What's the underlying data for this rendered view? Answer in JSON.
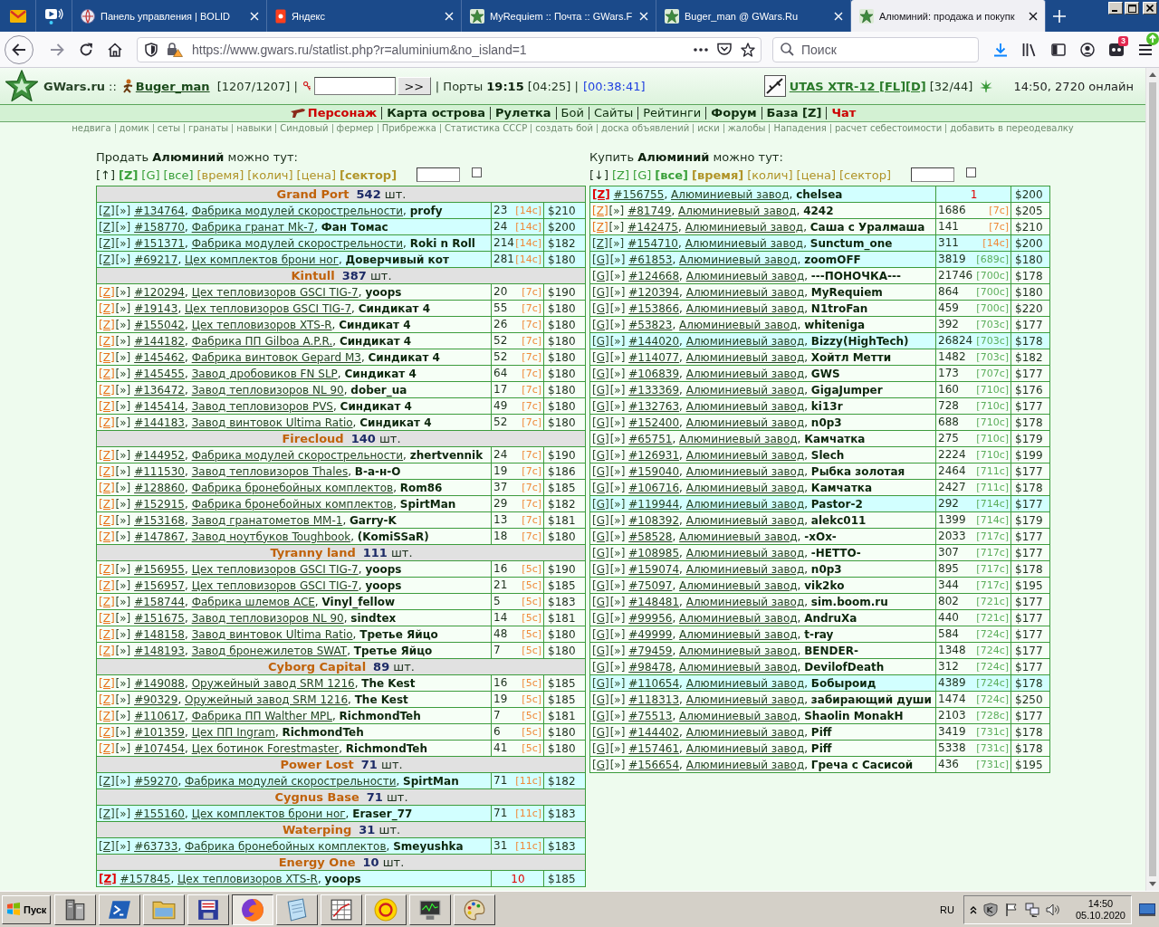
{
  "browser": {
    "tabs": [
      {
        "kind": "pinned",
        "selected": false
      },
      {
        "kind": "pinned",
        "selected": false
      },
      {
        "kind": "page",
        "label": "Панель управления | BOLID",
        "selected": false
      },
      {
        "kind": "page",
        "label": "Яндекс",
        "selected": false
      },
      {
        "kind": "page",
        "label": "MyRequiem :: Почта :: GWars.F",
        "selected": false
      },
      {
        "kind": "page",
        "label": "Buger_man @ GWars.Ru",
        "selected": false
      },
      {
        "kind": "page",
        "label": "Алюминий: продажа и покупк",
        "selected": true
      }
    ]
  },
  "toolbar": {
    "url": "https://www.gwars.ru/statlist.php?r=aluminium&no_island=1",
    "search_placeholder": "Поиск",
    "badge": "3"
  },
  "header": {
    "logo": "GWars.ru",
    "logo_sep": "::",
    "user": "Buger_man",
    "health": "[1207/1207] |",
    "go_button": ">>",
    "ports": "| Порты **19:15** [04:25] |",
    "timer": "[00:38:41]",
    "weapon": "UTAS XTR-12 [FL][D]",
    "ammo": "[32/44]",
    "online": "14:50, 2720 онлайн"
  },
  "nav": {
    "items": [
      {
        "label": "Персонаж",
        "bold": true,
        "color": "#cc0000"
      },
      {
        "label": "Карта острова",
        "bold": true,
        "color": "#0f2f0f"
      },
      {
        "label": "Рулетка",
        "bold": true,
        "color": "#0f2f0f"
      },
      {
        "label": "Бой",
        "bold": false,
        "color": "#0f2f0f"
      },
      {
        "label": "Сайты",
        "bold": false,
        "color": "#0f2f0f"
      },
      {
        "label": "Рейтинги",
        "bold": false,
        "color": "#0f2f0f"
      },
      {
        "label": "Форум",
        "bold": true,
        "color": "#0f2f0f"
      },
      {
        "label": "База [Z]",
        "bold": true,
        "color": "#0f2f0f"
      },
      {
        "label": "Чат",
        "bold": true,
        "color": "#cc0000"
      }
    ],
    "links": [
      "недвига",
      "домик",
      "сеты",
      "гранаты",
      "навыки",
      "Синдовый",
      "фермер",
      "Прибрежка",
      "Статистика СССР",
      "создать бой",
      "доска объявлений",
      "иски",
      "жалобы",
      "Нападения",
      "расчет себестоимости",
      "добавить в переодевалку"
    ]
  },
  "sell": {
    "title": "Продать **Алюминий** можно тут:",
    "filters": [
      {
        "label": "[↑]",
        "kind": "direction",
        "selected": false
      },
      {
        "label": "[Z]",
        "kind": "filter",
        "selected": true
      },
      {
        "label": "[G]",
        "kind": "filter",
        "selected": false
      },
      {
        "label": "[все]",
        "kind": "filter",
        "selected": false
      },
      {
        "label": "[время]",
        "kind": "sort",
        "selected": false
      },
      {
        "label": "[колич]",
        "kind": "sort",
        "selected": false
      },
      {
        "label": "[цена]",
        "kind": "sort",
        "selected": false
      },
      {
        "label": "[сектор]",
        "kind": "sort",
        "selected": true
      }
    ],
    "checkbox": {
      "checked": false
    },
    "separator": ",",
    "groups": [
      {
        "island": "Grand Port",
        "count": "542",
        "unit": "шт.",
        "rows": [
          {
            "kind": "offer",
            "highlighted": true,
            "tag": "[Z]",
            "tag_accent": false,
            "go": "[»]",
            "id": "#134764",
            "factory": "Фабрика модулей скорострельности",
            "owner": "profy",
            "qty": "23",
            "time": "[14c]",
            "time_accent": true,
            "price": "$210"
          },
          {
            "kind": "offer",
            "highlighted": true,
            "tag": "[Z]",
            "tag_accent": false,
            "go": "[»]",
            "id": "#158770",
            "factory": "Фабрика гранат Mk-7",
            "owner": "Фан Томас",
            "qty": "24",
            "time": "[14c]",
            "time_accent": true,
            "price": "$200"
          },
          {
            "kind": "offer",
            "highlighted": true,
            "tag": "[Z]",
            "tag_accent": false,
            "go": "[»]",
            "id": "#151371",
            "factory": "Фабрика модулей скорострельности",
            "owner": "Roki n Roll",
            "qty": "214",
            "time": "[14c]",
            "time_accent": true,
            "price": "$182"
          },
          {
            "kind": "offer",
            "highlighted": true,
            "tag": "[Z]",
            "tag_accent": false,
            "go": "[»]",
            "id": "#69217",
            "factory": "Цех комплектов брони ног",
            "owner": "Доверчивый кот",
            "qty": "281",
            "time": "[14c]",
            "time_accent": true,
            "price": "$180"
          }
        ]
      },
      {
        "island": "Kintull",
        "count": "387",
        "unit": "шт.",
        "rows": [
          {
            "kind": "offer",
            "highlighted": false,
            "tag": "[Z]",
            "tag_accent": true,
            "go": "[»]",
            "id": "#120294",
            "factory": "Цех тепловизоров GSCI TIG-7",
            "owner": "yoops",
            "qty": "20",
            "time": "[7c]",
            "time_accent": true,
            "price": "$190"
          },
          {
            "kind": "offer",
            "highlighted": false,
            "tag": "[Z]",
            "tag_accent": true,
            "go": "[»]",
            "id": "#19143",
            "factory": "Цех тепловизоров GSCI TIG-7",
            "owner": "Синдикат 4",
            "qty": "55",
            "time": "[7c]",
            "time_accent": true,
            "price": "$180"
          },
          {
            "kind": "offer",
            "highlighted": false,
            "tag": "[Z]",
            "tag_accent": true,
            "go": "[»]",
            "id": "#155042",
            "factory": "Цех тепловизоров XTS-R",
            "owner": "Синдикат 4",
            "qty": "26",
            "time": "[7c]",
            "time_accent": true,
            "price": "$180"
          },
          {
            "kind": "offer",
            "highlighted": false,
            "tag": "[Z]",
            "tag_accent": true,
            "go": "[»]",
            "id": "#144182",
            "factory": "Фабрика ПП Gilboa A.P.R.",
            "owner": "Синдикат 4",
            "qty": "52",
            "time": "[7c]",
            "time_accent": true,
            "price": "$180"
          },
          {
            "kind": "offer",
            "highlighted": false,
            "tag": "[Z]",
            "tag_accent": true,
            "go": "[»]",
            "id": "#145462",
            "factory": "Фабрика винтовок Gepard M3",
            "owner": "Синдикат 4",
            "qty": "52",
            "time": "[7c]",
            "time_accent": true,
            "price": "$180"
          },
          {
            "kind": "offer",
            "highlighted": false,
            "tag": "[Z]",
            "tag_accent": true,
            "go": "[»]",
            "id": "#145455",
            "factory": "Завод дробовиков FN SLP",
            "owner": "Синдикат 4",
            "qty": "64",
            "time": "[7c]",
            "time_accent": true,
            "price": "$180"
          },
          {
            "kind": "offer",
            "highlighted": false,
            "tag": "[Z]",
            "tag_accent": true,
            "go": "[»]",
            "id": "#136472",
            "factory": "Завод тепловизоров NL 90",
            "owner": "dober_ua",
            "qty": "17",
            "time": "[7c]",
            "time_accent": true,
            "price": "$180"
          },
          {
            "kind": "offer",
            "highlighted": false,
            "tag": "[Z]",
            "tag_accent": true,
            "go": "[»]",
            "id": "#145414",
            "factory": "Завод тепловизоров PVS",
            "owner": "Синдикат 4",
            "qty": "49",
            "time": "[7c]",
            "time_accent": true,
            "price": "$180"
          },
          {
            "kind": "offer",
            "highlighted": false,
            "tag": "[Z]",
            "tag_accent": true,
            "go": "[»]",
            "id": "#144183",
            "factory": "Завод винтовок Ultima Ratio",
            "owner": "Синдикат 4",
            "qty": "52",
            "time": "[7c]",
            "time_accent": true,
            "price": "$180"
          }
        ]
      },
      {
        "island": "Firecloud",
        "count": "140",
        "unit": "шт.",
        "rows": [
          {
            "kind": "offer",
            "highlighted": false,
            "tag": "[Z]",
            "tag_accent": true,
            "go": "[»]",
            "id": "#144952",
            "factory": "Фабрика модулей скорострельности",
            "owner": "zhertvennik",
            "qty": "24",
            "time": "[7c]",
            "time_accent": true,
            "price": "$190"
          },
          {
            "kind": "offer",
            "highlighted": false,
            "tag": "[Z]",
            "tag_accent": true,
            "go": "[»]",
            "id": "#111530",
            "factory": "Завод тепловизоров Thales",
            "owner": "В-а-н-О",
            "qty": "19",
            "time": "[7c]",
            "time_accent": true,
            "price": "$186"
          },
          {
            "kind": "offer",
            "highlighted": false,
            "tag": "[Z]",
            "tag_accent": true,
            "go": "[»]",
            "id": "#128860",
            "factory": "Фабрика бронебойных комплектов",
            "owner": "Rom86",
            "qty": "37",
            "time": "[7c]",
            "time_accent": true,
            "price": "$185"
          },
          {
            "kind": "offer",
            "highlighted": false,
            "tag": "[Z]",
            "tag_accent": true,
            "go": "[»]",
            "id": "#152915",
            "factory": "Фабрика бронебойных комплектов",
            "owner": "SpirtMan",
            "qty": "29",
            "time": "[7c]",
            "time_accent": true,
            "price": "$182"
          },
          {
            "kind": "offer",
            "highlighted": false,
            "tag": "[Z]",
            "tag_accent": true,
            "go": "[»]",
            "id": "#153168",
            "factory": "Завод гранатометов MM-1",
            "owner": "Garry-K",
            "qty": "13",
            "time": "[7c]",
            "time_accent": true,
            "price": "$181"
          },
          {
            "kind": "offer",
            "highlighted": false,
            "tag": "[Z]",
            "tag_accent": true,
            "go": "[»]",
            "id": "#147867",
            "factory": "Завод ноутбуков Toughbook",
            "owner": "(KomiSSaR)",
            "qty": "18",
            "time": "[7c]",
            "time_accent": true,
            "price": "$180"
          }
        ]
      },
      {
        "island": "Tyranny land",
        "count": "111",
        "unit": "шт.",
        "rows": [
          {
            "kind": "offer",
            "highlighted": false,
            "tag": "[Z]",
            "tag_accent": true,
            "go": "[»]",
            "id": "#156955",
            "factory": "Цех тепловизоров GSCI TIG-7",
            "owner": "yoops",
            "qty": "16",
            "time": "[5c]",
            "time_accent": true,
            "price": "$190"
          },
          {
            "kind": "offer",
            "highlighted": false,
            "tag": "[Z]",
            "tag_accent": true,
            "go": "[»]",
            "id": "#156957",
            "factory": "Цех тепловизоров GSCI TIG-7",
            "owner": "yoops",
            "qty": "21",
            "time": "[5c]",
            "time_accent": true,
            "price": "$185"
          },
          {
            "kind": "offer",
            "highlighted": false,
            "tag": "[Z]",
            "tag_accent": true,
            "go": "[»]",
            "id": "#158744",
            "factory": "Фабрика шлемов ACE",
            "owner": "Vinyl_fellow",
            "qty": "5",
            "time": "[5c]",
            "time_accent": true,
            "price": "$183"
          },
          {
            "kind": "offer",
            "highlighted": false,
            "tag": "[Z]",
            "tag_accent": true,
            "go": "[»]",
            "id": "#151675",
            "factory": "Завод тепловизоров NL 90",
            "owner": "sindtex",
            "qty": "14",
            "time": "[5c]",
            "time_accent": true,
            "price": "$181"
          },
          {
            "kind": "offer",
            "highlighted": false,
            "tag": "[Z]",
            "tag_accent": true,
            "go": "[»]",
            "id": "#148158",
            "factory": "Завод винтовок Ultima Ratio",
            "owner": "Третье Яйцо",
            "qty": "48",
            "time": "[5c]",
            "time_accent": true,
            "price": "$180"
          },
          {
            "kind": "offer",
            "highlighted": false,
            "tag": "[Z]",
            "tag_accent": true,
            "go": "[»]",
            "id": "#148193",
            "factory": "Завод бронежилетов SWAT",
            "owner": "Третье Яйцо",
            "qty": "7",
            "time": "[5c]",
            "time_accent": true,
            "price": "$180"
          }
        ]
      },
      {
        "island": "Cyborg Capital",
        "count": "89",
        "unit": "шт.",
        "rows": [
          {
            "kind": "offer",
            "highlighted": false,
            "tag": "[Z]",
            "tag_accent": true,
            "go": "[»]",
            "id": "#149088",
            "factory": "Оружейный завод SRM 1216",
            "owner": "The Kest",
            "qty": "16",
            "time": "[5c]",
            "time_accent": true,
            "price": "$185"
          },
          {
            "kind": "offer",
            "highlighted": false,
            "tag": "[Z]",
            "tag_accent": true,
            "go": "[»]",
            "id": "#90329",
            "factory": "Оружейный завод SRM 1216",
            "owner": "The Kest",
            "qty": "19",
            "time": "[5c]",
            "time_accent": true,
            "price": "$185"
          },
          {
            "kind": "offer",
            "highlighted": false,
            "tag": "[Z]",
            "tag_accent": true,
            "go": "[»]",
            "id": "#110617",
            "factory": "Фабрика ПП Walther MPL",
            "owner": "RichmondTeh",
            "qty": "7",
            "time": "[5c]",
            "time_accent": true,
            "price": "$181"
          },
          {
            "kind": "offer",
            "highlighted": false,
            "tag": "[Z]",
            "tag_accent": true,
            "go": "[»]",
            "id": "#101359",
            "factory": "Цех ПП Ingram",
            "owner": "RichmondTeh",
            "qty": "6",
            "time": "[5c]",
            "time_accent": true,
            "price": "$180"
          },
          {
            "kind": "offer",
            "highlighted": false,
            "tag": "[Z]",
            "tag_accent": true,
            "go": "[»]",
            "id": "#107454",
            "factory": "Цех ботинок Forestmaster",
            "owner": "RichmondTeh",
            "qty": "41",
            "time": "[5c]",
            "time_accent": true,
            "price": "$180"
          }
        ]
      },
      {
        "island": "Power Lost",
        "count": "71",
        "unit": "шт.",
        "rows": [
          {
            "kind": "offer",
            "highlighted": true,
            "tag": "[Z]",
            "tag_accent": false,
            "go": "[»]",
            "id": "#59270",
            "factory": "Фабрика модулей скорострельности",
            "owner": "SpirtMan",
            "qty": "71",
            "time": "[11c]",
            "time_accent": true,
            "price": "$182"
          }
        ]
      },
      {
        "island": "Cygnus Base",
        "count": "71",
        "unit": "шт.",
        "rows": [
          {
            "kind": "offer",
            "highlighted": true,
            "tag": "[Z]",
            "tag_accent": false,
            "go": "[»]",
            "id": "#155160",
            "factory": "Цех комплектов брони ног",
            "owner": "Eraser_77",
            "qty": "71",
            "time": "[11c]",
            "time_accent": true,
            "price": "$183"
          }
        ]
      },
      {
        "island": "Waterping",
        "count": "31",
        "unit": "шт.",
        "rows": [
          {
            "kind": "offer",
            "highlighted": true,
            "tag": "[Z]",
            "tag_accent": false,
            "go": "[»]",
            "id": "#63733",
            "factory": "Фабрика бронебойных комплектов",
            "owner": "Smeyushka",
            "qty": "31",
            "time": "[11c]",
            "time_accent": true,
            "price": "$183"
          }
        ]
      },
      {
        "island": "Energy One",
        "count": "10",
        "unit": "шт.",
        "rows": [
          {
            "kind": "own",
            "highlighted": true,
            "tag": "[Z]",
            "id": "#157845",
            "factory": "Цех тепловизоров XTS-R",
            "owner": "yoops",
            "qty": "10",
            "price": "$185"
          }
        ]
      }
    ]
  },
  "buy": {
    "title": "Купить **Алюминий** можно тут:",
    "filters": [
      {
        "label": "[↓]",
        "kind": "direction",
        "selected": false
      },
      {
        "label": "[Z]",
        "kind": "filter",
        "selected": false
      },
      {
        "label": "[G]",
        "kind": "filter",
        "selected": false
      },
      {
        "label": "[все]",
        "kind": "filter",
        "selected": true
      },
      {
        "label": "[время]",
        "kind": "sort",
        "selected": true
      },
      {
        "label": "[колич]",
        "kind": "sort",
        "selected": false
      },
      {
        "label": "[цена]",
        "kind": "sort",
        "selected": false
      },
      {
        "label": "[сектор]",
        "kind": "sort",
        "selected": false
      }
    ],
    "checkbox": {
      "checked": false
    },
    "separator": ",",
    "rows": [
      {
        "kind": "own",
        "highlighted": true,
        "tag": "[Z]",
        "id": "#156755",
        "factory": "Алюминиевый завод",
        "owner": "chelsea",
        "qty": "1",
        "price": "$200"
      },
      {
        "kind": "offer",
        "highlighted": false,
        "tag": "[Z]",
        "tag_accent": true,
        "go": "[»]",
        "id": "#81749",
        "factory": "Алюминиевый завод",
        "owner": "4242",
        "qty": "1686",
        "time": "[7c]",
        "time_accent": true,
        "price": "$205"
      },
      {
        "kind": "offer",
        "highlighted": false,
        "tag": "[Z]",
        "tag_accent": true,
        "go": "[»]",
        "id": "#142475",
        "factory": "Алюминиевый завод",
        "owner": "Саша с Уралмаша",
        "qty": "141",
        "time": "[7c]",
        "time_accent": true,
        "price": "$210"
      },
      {
        "kind": "offer",
        "highlighted": true,
        "tag": "[Z]",
        "tag_accent": false,
        "go": "[»]",
        "id": "#154710",
        "factory": "Алюминиевый завод",
        "owner": "Sunctum_one",
        "qty": "311",
        "time": "[14c]",
        "time_accent": true,
        "price": "$200"
      },
      {
        "kind": "offer",
        "highlighted": true,
        "tag": "[G]",
        "tag_accent": false,
        "go": "[»]",
        "id": "#61853",
        "factory": "Алюминиевый завод",
        "owner": "zoomOFF",
        "qty": "3819",
        "time": "[689c]",
        "time_accent": false,
        "price": "$180"
      },
      {
        "kind": "offer",
        "highlighted": false,
        "tag": "[G]",
        "tag_accent": false,
        "go": "[»]",
        "id": "#124668",
        "factory": "Алюминиевый завод",
        "owner": "---ПОНОЧКА---",
        "qty": "21746",
        "time": "[700c]",
        "time_accent": false,
        "price": "$178"
      },
      {
        "kind": "offer",
        "highlighted": false,
        "tag": "[G]",
        "tag_accent": false,
        "go": "[»]",
        "id": "#120394",
        "factory": "Алюминиевый завод",
        "owner": "MyRequiem",
        "qty": "864",
        "time": "[700c]",
        "time_accent": false,
        "price": "$180"
      },
      {
        "kind": "offer",
        "highlighted": false,
        "tag": "[G]",
        "tag_accent": false,
        "go": "[»]",
        "id": "#153866",
        "factory": "Алюминиевый завод",
        "owner": "N1troFan",
        "qty": "459",
        "time": "[700c]",
        "time_accent": false,
        "price": "$220"
      },
      {
        "kind": "offer",
        "highlighted": false,
        "tag": "[G]",
        "tag_accent": false,
        "go": "[»]",
        "id": "#53823",
        "factory": "Алюминиевый завод",
        "owner": "whiteniga",
        "qty": "392",
        "time": "[703c]",
        "time_accent": false,
        "price": "$177"
      },
      {
        "kind": "offer",
        "highlighted": true,
        "tag": "[G]",
        "tag_accent": false,
        "go": "[»]",
        "id": "#144020",
        "factory": "Алюминиевый завод",
        "owner": "Bizzy(HighTech)",
        "qty": "26824",
        "time": "[703c]",
        "time_accent": false,
        "price": "$178"
      },
      {
        "kind": "offer",
        "highlighted": false,
        "tag": "[G]",
        "tag_accent": false,
        "go": "[»]",
        "id": "#114077",
        "factory": "Алюминиевый завод",
        "owner": "Хойтл Метти",
        "qty": "1482",
        "time": "[703c]",
        "time_accent": false,
        "price": "$182"
      },
      {
        "kind": "offer",
        "highlighted": false,
        "tag": "[G]",
        "tag_accent": false,
        "go": "[»]",
        "id": "#106839",
        "factory": "Алюминиевый завод",
        "owner": "GWS",
        "qty": "173",
        "time": "[707c]",
        "time_accent": false,
        "price": "$177"
      },
      {
        "kind": "offer",
        "highlighted": false,
        "tag": "[G]",
        "tag_accent": false,
        "go": "[»]",
        "id": "#133369",
        "factory": "Алюминиевый завод",
        "owner": "GigaJumper",
        "qty": "160",
        "time": "[710c]",
        "time_accent": false,
        "price": "$176"
      },
      {
        "kind": "offer",
        "highlighted": false,
        "tag": "[G]",
        "tag_accent": false,
        "go": "[»]",
        "id": "#132763",
        "factory": "Алюминиевый завод",
        "owner": "ki13r",
        "qty": "728",
        "time": "[710c]",
        "time_accent": false,
        "price": "$177"
      },
      {
        "kind": "offer",
        "highlighted": false,
        "tag": "[G]",
        "tag_accent": false,
        "go": "[»]",
        "id": "#152400",
        "factory": "Алюминиевый завод",
        "owner": "n0p3",
        "qty": "688",
        "time": "[710c]",
        "time_accent": false,
        "price": "$178"
      },
      {
        "kind": "offer",
        "highlighted": false,
        "tag": "[G]",
        "tag_accent": false,
        "go": "[»]",
        "id": "#65751",
        "factory": "Алюминиевый завод",
        "owner": "Камчатка",
        "qty": "275",
        "time": "[710c]",
        "time_accent": false,
        "price": "$179"
      },
      {
        "kind": "offer",
        "highlighted": false,
        "tag": "[G]",
        "tag_accent": false,
        "go": "[»]",
        "id": "#126931",
        "factory": "Алюминиевый завод",
        "owner": "Slech",
        "qty": "2224",
        "time": "[710c]",
        "time_accent": false,
        "price": "$199"
      },
      {
        "kind": "offer",
        "highlighted": false,
        "tag": "[G]",
        "tag_accent": false,
        "go": "[»]",
        "id": "#159040",
        "factory": "Алюминиевый завод",
        "owner": "Рыбка золотая",
        "qty": "2464",
        "time": "[711c]",
        "time_accent": false,
        "price": "$177"
      },
      {
        "kind": "offer",
        "highlighted": false,
        "tag": "[G]",
        "tag_accent": false,
        "go": "[»]",
        "id": "#106716",
        "factory": "Алюминиевый завод",
        "owner": "Камчатка",
        "qty": "2427",
        "time": "[711c]",
        "time_accent": false,
        "price": "$178"
      },
      {
        "kind": "offer",
        "highlighted": true,
        "tag": "[G]",
        "tag_accent": false,
        "go": "[»]",
        "id": "#119944",
        "factory": "Алюминиевый завод",
        "owner": "Pastor-2",
        "qty": "292",
        "time": "[714c]",
        "time_accent": false,
        "price": "$177"
      },
      {
        "kind": "offer",
        "highlighted": false,
        "tag": "[G]",
        "tag_accent": false,
        "go": "[»]",
        "id": "#108392",
        "factory": "Алюминиевый завод",
        "owner": "alekc011",
        "qty": "1399",
        "time": "[714c]",
        "time_accent": false,
        "price": "$179"
      },
      {
        "kind": "offer",
        "highlighted": false,
        "tag": "[G]",
        "tag_accent": false,
        "go": "[»]",
        "id": "#58528",
        "factory": "Алюминиевый завод",
        "owner": "-xOx-",
        "qty": "2033",
        "time": "[717c]",
        "time_accent": false,
        "price": "$177"
      },
      {
        "kind": "offer",
        "highlighted": false,
        "tag": "[G]",
        "tag_accent": false,
        "go": "[»]",
        "id": "#108985",
        "factory": "Алюминиевый завод",
        "owner": "-НЕТТО-",
        "qty": "307",
        "time": "[717c]",
        "time_accent": false,
        "price": "$177"
      },
      {
        "kind": "offer",
        "highlighted": false,
        "tag": "[G]",
        "tag_accent": false,
        "go": "[»]",
        "id": "#159074",
        "factory": "Алюминиевый завод",
        "owner": "n0p3",
        "qty": "895",
        "time": "[717c]",
        "time_accent": false,
        "price": "$178"
      },
      {
        "kind": "offer",
        "highlighted": false,
        "tag": "[G]",
        "tag_accent": false,
        "go": "[»]",
        "id": "#75097",
        "factory": "Алюминиевый завод",
        "owner": "vik2ko",
        "qty": "344",
        "time": "[717c]",
        "time_accent": false,
        "price": "$195"
      },
      {
        "kind": "offer",
        "highlighted": false,
        "tag": "[G]",
        "tag_accent": false,
        "go": "[»]",
        "id": "#148481",
        "factory": "Алюминиевый завод",
        "owner": "sim.boom.ru",
        "qty": "802",
        "time": "[721c]",
        "time_accent": false,
        "price": "$177"
      },
      {
        "kind": "offer",
        "highlighted": false,
        "tag": "[G]",
        "tag_accent": false,
        "go": "[»]",
        "id": "#99956",
        "factory": "Алюминиевый завод",
        "owner": "AndruXa",
        "qty": "440",
        "time": "[721c]",
        "time_accent": false,
        "price": "$177"
      },
      {
        "kind": "offer",
        "highlighted": false,
        "tag": "[G]",
        "tag_accent": false,
        "go": "[»]",
        "id": "#49999",
        "factory": "Алюминиевый завод",
        "owner": "t-ray",
        "qty": "584",
        "time": "[724c]",
        "time_accent": false,
        "price": "$177"
      },
      {
        "kind": "offer",
        "highlighted": false,
        "tag": "[G]",
        "tag_accent": false,
        "go": "[»]",
        "id": "#79459",
        "factory": "Алюминиевый завод",
        "owner": "BENDER-",
        "qty": "1348",
        "time": "[724c]",
        "time_accent": false,
        "price": "$177"
      },
      {
        "kind": "offer",
        "highlighted": false,
        "tag": "[G]",
        "tag_accent": false,
        "go": "[»]",
        "id": "#98478",
        "factory": "Алюминиевый завод",
        "owner": "DevilofDeath",
        "qty": "312",
        "time": "[724c]",
        "time_accent": false,
        "price": "$177"
      },
      {
        "kind": "offer",
        "highlighted": true,
        "tag": "[G]",
        "tag_accent": false,
        "go": "[»]",
        "id": "#110654",
        "factory": "Алюминиевый завод",
        "owner": "Бобыроид",
        "qty": "4389",
        "time": "[724c]",
        "time_accent": false,
        "price": "$178"
      },
      {
        "kind": "offer",
        "highlighted": false,
        "tag": "[G]",
        "tag_accent": false,
        "go": "[»]",
        "id": "#118313",
        "factory": "Алюминиевый завод",
        "owner": "забирающий души",
        "qty": "1474",
        "time": "[724c]",
        "time_accent": false,
        "price": "$250"
      },
      {
        "kind": "offer",
        "highlighted": false,
        "tag": "[G]",
        "tag_accent": false,
        "go": "[»]",
        "id": "#75513",
        "factory": "Алюминиевый завод",
        "owner": "Shaolin MonakH",
        "qty": "2103",
        "time": "[728c]",
        "time_accent": false,
        "price": "$177"
      },
      {
        "kind": "offer",
        "highlighted": false,
        "tag": "[G]",
        "tag_accent": false,
        "go": "[»]",
        "id": "#144402",
        "factory": "Алюминиевый завод",
        "owner": "Piff",
        "qty": "3419",
        "time": "[731c]",
        "time_accent": false,
        "price": "$178"
      },
      {
        "kind": "offer",
        "highlighted": false,
        "tag": "[G]",
        "tag_accent": false,
        "go": "[»]",
        "id": "#157461",
        "factory": "Алюминиевый завод",
        "owner": "Piff",
        "qty": "5338",
        "time": "[731c]",
        "time_accent": false,
        "price": "$178"
      },
      {
        "kind": "offer",
        "highlighted": false,
        "tag": "[G]",
        "tag_accent": false,
        "go": "[»]",
        "id": "#156654",
        "factory": "Алюминиевый завод",
        "owner": "Греча с Сасисой",
        "qty": "436",
        "time": "[731c]",
        "time_accent": false,
        "price": "$195"
      }
    ]
  },
  "taskbar": {
    "start": "Пуск",
    "apps": [
      {
        "selected": false
      },
      {
        "selected": false
      },
      {
        "selected": false
      },
      {
        "selected": false
      },
      {
        "selected": true
      },
      {
        "selected": false
      },
      {
        "selected": false
      },
      {
        "selected": false
      },
      {
        "selected": false
      },
      {
        "selected": false
      }
    ],
    "language": "RU",
    "time": "14:50",
    "date": "05.10.2020"
  }
}
